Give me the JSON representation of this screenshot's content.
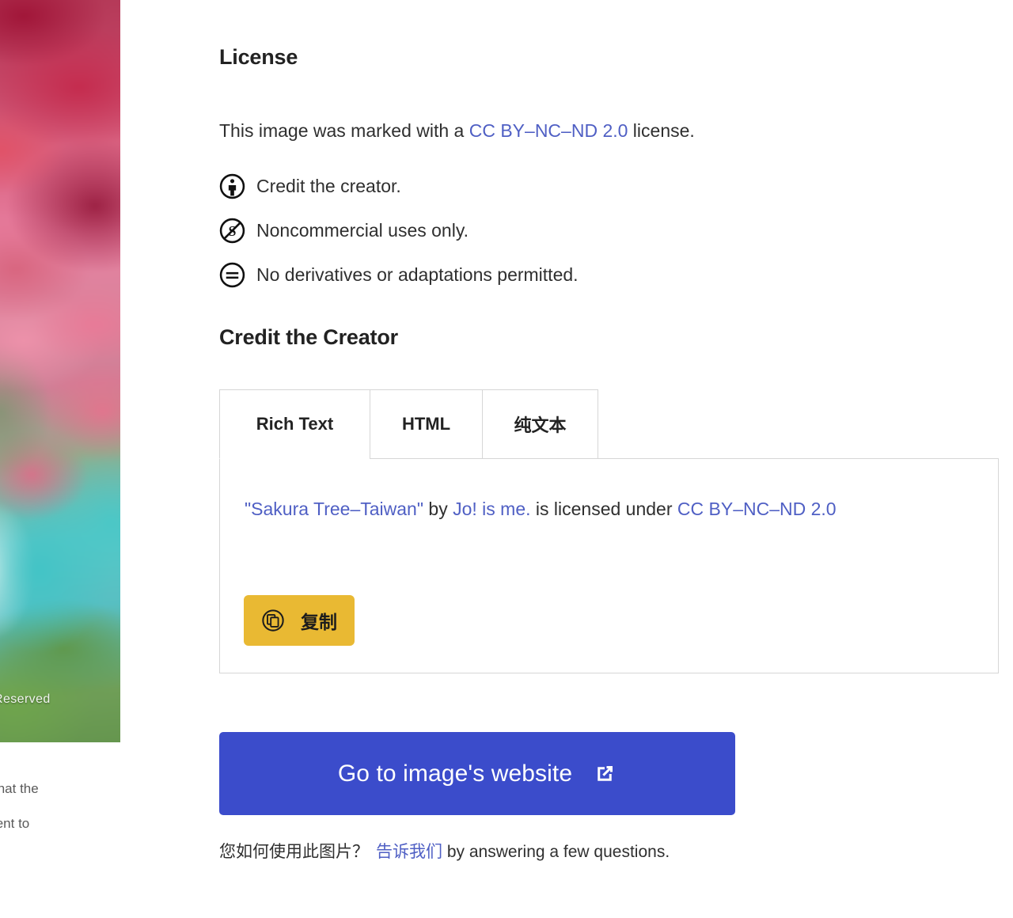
{
  "photo": {
    "alt_subject": "sakura-tree-blossoms",
    "watermark": "Reserved"
  },
  "left_column_text": {
    "fragment_1": "that the",
    "fragment_2": "tent to"
  },
  "license": {
    "heading": "License",
    "statement_prefix": "This image was marked with a ",
    "statement_link": "CC BY–NC–ND 2.0",
    "statement_suffix": " license.",
    "conditions": [
      {
        "icon": "cc-by-icon",
        "label": "Credit the creator."
      },
      {
        "icon": "cc-nc-icon",
        "label": "Noncommercial uses only."
      },
      {
        "icon": "cc-nd-icon",
        "label": "No derivatives or adaptations permitted."
      }
    ]
  },
  "credit": {
    "heading": "Credit the Creator",
    "tabs": [
      {
        "label": "Rich Text",
        "active": true
      },
      {
        "label": "HTML",
        "active": false
      },
      {
        "label": "纯文本",
        "active": false
      }
    ],
    "attribution": {
      "title_link": "\"Sakura Tree–Taiwan\"",
      "by_word": " by ",
      "author_link": "Jo! is me.",
      "middle": " is licensed under ",
      "license_link": "CC BY–NC–ND 2.0"
    },
    "copy_button": {
      "label": "复制",
      "icon": "copy-icon"
    }
  },
  "cta": {
    "label": "Go to image's website",
    "icon": "external-link-icon"
  },
  "footer": {
    "question": "您如何使用此图片？",
    "link": "告诉我们",
    "suffix": " by answering a few questions."
  },
  "colors": {
    "link": "#4f5fc4",
    "cta_background": "#3b4ccb",
    "copy_background": "#e9b933",
    "text": "#2f2f2f",
    "border": "#d6d6d6"
  }
}
